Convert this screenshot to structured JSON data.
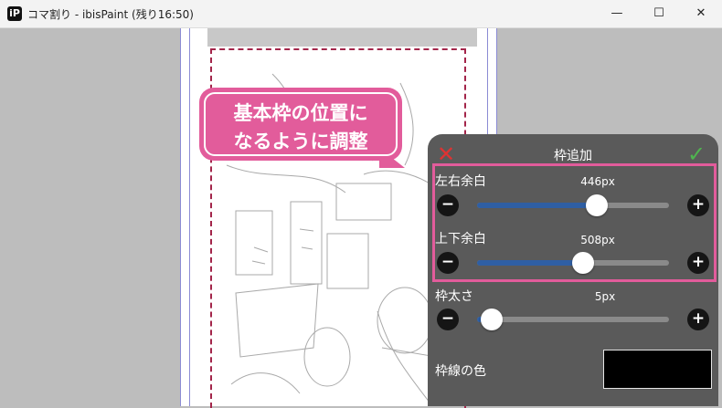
{
  "window": {
    "icon_glyph": "iP",
    "title": "コマ割り - ibisPaint (残り16:50)",
    "controls": {
      "minimize": "—",
      "maximize": "☐",
      "close": "✕"
    }
  },
  "callout": {
    "line1": "基本枠の位置に",
    "line2": "なるように調整"
  },
  "panel": {
    "title": "枠追加",
    "cancel_glyph": "✕",
    "ok_glyph": "✓",
    "sliders": [
      {
        "label": "左右余白",
        "value_text": "446px",
        "level": 0.63
      },
      {
        "label": "上下余白",
        "value_text": "508px",
        "level": 0.55
      },
      {
        "label": "枠太さ",
        "value_text": "5px",
        "level": 0.0
      }
    ],
    "minus_glyph": "−",
    "plus_glyph": "+",
    "color_label": "枠線の色",
    "color_value": "#000000"
  },
  "colors": {
    "accent_pink": "#e25c9b",
    "slider_fill": "#2f5fa4",
    "frame_line": "#a3254a"
  }
}
